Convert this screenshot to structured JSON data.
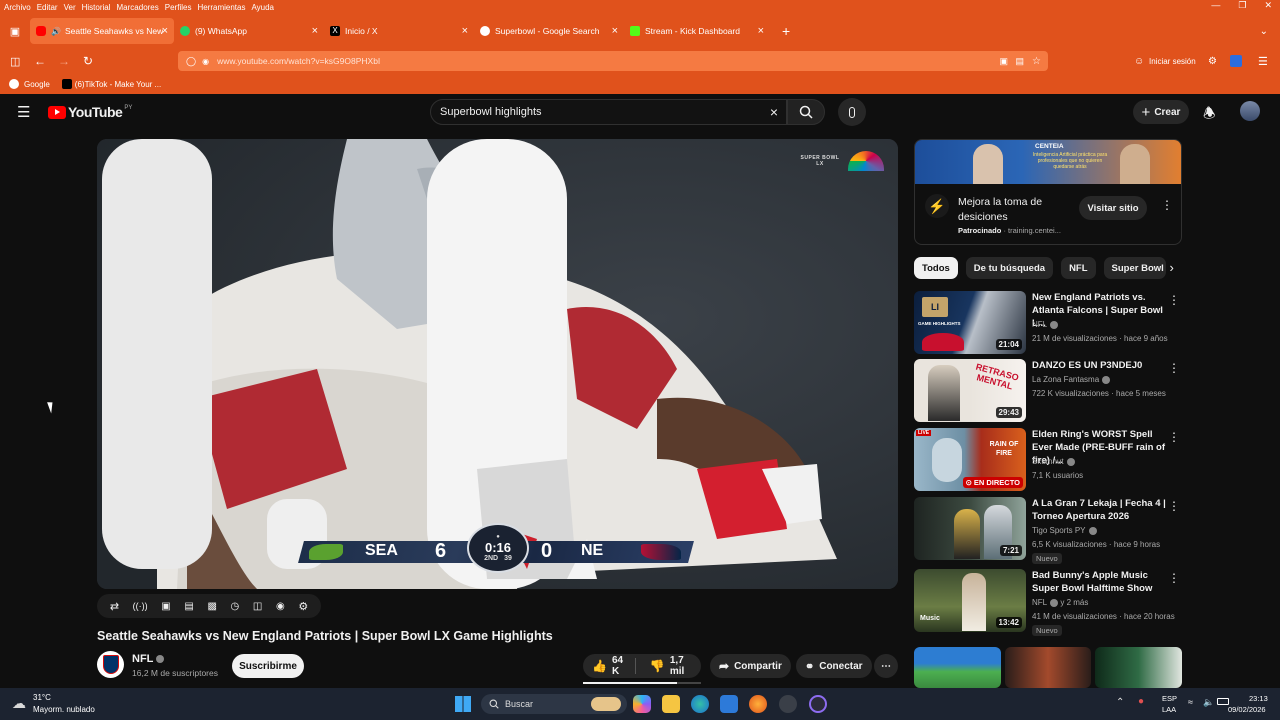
{
  "browser": {
    "menu": [
      "Archivo",
      "Editar",
      "Ver",
      "Historial",
      "Marcadores",
      "Perfiles",
      "Herramientas",
      "Ayuda"
    ],
    "tabs": [
      {
        "label": "Seattle Seahawks vs New E",
        "favicon": "youtube-icon",
        "active": true
      },
      {
        "label": "(9) WhatsApp",
        "favicon": "whatsapp-icon"
      },
      {
        "label": "Inicio / X",
        "favicon": "x-icon"
      },
      {
        "label": "Superbowl - Google Search",
        "favicon": "google-icon"
      },
      {
        "label": "Stream - Kick Dashboard",
        "favicon": "kick-icon"
      }
    ],
    "url": "www.youtube.com/watch?v=ksG9O8PHXbI",
    "signin": "Iniciar sesión",
    "bookmarks": [
      {
        "label": "Google",
        "icon": "google-icon"
      },
      {
        "label": "(6)TikTok - Make Your ...",
        "icon": "tiktok-icon"
      }
    ],
    "colors": {
      "chrome": "#e0521c",
      "active_tab": "#f16e36"
    }
  },
  "youtube": {
    "logo": "YouTube",
    "country": "PY",
    "search_query": "Superbowl highlights",
    "create_label": "Crear"
  },
  "video": {
    "title": "Seattle Seahawks vs New England Patriots | Super Bowl LX Game Highlights",
    "watermark": "SUPER BOWL LX",
    "scorebug": {
      "away": "SEA",
      "away_score": "6",
      "clock": "0:16",
      "quarter": "2ND",
      "play_clock": "39",
      "home_score": "0",
      "home": "NE"
    },
    "channel": {
      "name": "NFL",
      "subscribers": "16,2 M de suscriptores"
    },
    "subscribe_label": "Suscribirme",
    "likes": "64 K",
    "dislikes": "1,7 mil",
    "share_label": "Compartir",
    "connect_label": "Conectar"
  },
  "ad": {
    "banner_brand": "CENTEIA",
    "banner_text": "Inteligencia Artificial práctica para profesionales que no quieren quedarse atrás",
    "title": "Mejora la toma de desiciones",
    "sponsored": "Patrocinado",
    "domain": "training.centei...",
    "cta": "Visitar sitio"
  },
  "chips": [
    "Todos",
    "De tu búsqueda",
    "NFL",
    "Super Bowl"
  ],
  "recommendations": [
    {
      "title": "New England Patriots vs. Atlanta Falcons | Super Bowl L...",
      "channel": "NFL",
      "verified": true,
      "meta": "21 M de visualizaciones · hace 9 años",
      "duration": "21:04",
      "thumb_text": "GAME HIGHLIGHTS"
    },
    {
      "title": "DANZO ES UN P3NDEJ0",
      "channel": "La Zona Fantasma",
      "verified": true,
      "meta": "722 K visualizaciones · hace 5 meses",
      "duration": "29:43",
      "thumb_text": "RETRASO MENTAL"
    },
    {
      "title": "Elden Ring's WORST Spell Ever Made (PRE-BUFF rain of fire) /...",
      "channel": "Skumnut",
      "verified": true,
      "meta": "7,1 K usuarios",
      "duration": "EN DIRECTO",
      "live_tag": "LIVE",
      "thumb_text": "RAIN OF FIRE"
    },
    {
      "title": "A La Gran 7 Lekaja | Fecha 4 | Torneo Apertura 2026",
      "channel": "Tigo Sports PY",
      "verified": true,
      "meta": "6,5 K visualizaciones · hace 9 horas",
      "duration": "7:21",
      "badge": "Nuevo"
    },
    {
      "title": "Bad Bunny's Apple Music Super Bowl Halftime Show",
      "channel": "NFL",
      "verified": true,
      "channel_extra": "y 2 más",
      "meta": "41 M de visualizaciones · hace 20 horas",
      "duration": "13:42",
      "badge": "Nuevo",
      "thumb_text": "Music"
    }
  ],
  "taskbar": {
    "weather_temp": "31°C",
    "weather_desc": "Mayorm. nublado",
    "search_label": "Buscar",
    "lang": "ESP",
    "lang2": "LAA",
    "time": "23:13",
    "date": "09/02/2026"
  }
}
